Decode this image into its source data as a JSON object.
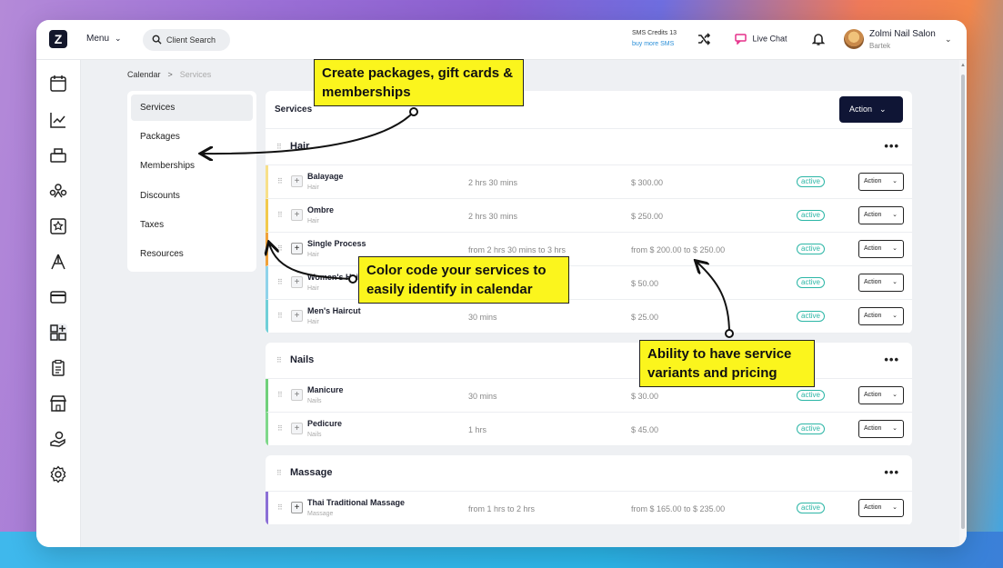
{
  "app": {
    "logo_letter": "Z",
    "menu_label": "Menu",
    "search_label": "Client Search",
    "sms_credits": "SMS Credits 13",
    "buy_sms": "buy more SMS",
    "live_chat": "Live Chat",
    "user_name": "Zolmi Nail Salon",
    "user_sub": "Bartek"
  },
  "breadcrumb": {
    "root": "Calendar",
    "sep": ">",
    "current": "Services"
  },
  "submenu": [
    "Services",
    "Packages",
    "Memberships",
    "Discounts",
    "Taxes",
    "Resources"
  ],
  "main": {
    "title": "Services",
    "action_label": "Action"
  },
  "categories": [
    {
      "name": "Hair",
      "rows": [
        {
          "name": "Balayage",
          "cat": "Hair",
          "duration": "2 hrs 30 mins",
          "price": "$ 300.00",
          "status": "active",
          "action": "Action",
          "color": "#f7e08a",
          "plus_dark": false
        },
        {
          "name": "Ombre",
          "cat": "Hair",
          "duration": "2 hrs 30 mins",
          "price": "$ 250.00",
          "status": "active",
          "action": "Action",
          "color": "#f2c94c",
          "plus_dark": false
        },
        {
          "name": "Single Process",
          "cat": "Hair",
          "duration": "from 2 hrs 30 mins to 3 hrs",
          "price": "from $ 200.00 to $ 250.00",
          "status": "active",
          "action": "Action",
          "color": "#f0a23a",
          "plus_dark": true
        },
        {
          "name": "Women's Haircut",
          "cat": "Hair",
          "duration": "",
          "price": "$ 50.00",
          "status": "active",
          "action": "Action",
          "color": "#8fd3ea",
          "plus_dark": false
        },
        {
          "name": "Men's Haircut",
          "cat": "Hair",
          "duration": "30 mins",
          "price": "$ 25.00",
          "status": "active",
          "action": "Action",
          "color": "#6fcfd8",
          "plus_dark": false
        }
      ]
    },
    {
      "name": "Nails",
      "rows": [
        {
          "name": "Manicure",
          "cat": "Nails",
          "duration": "30 mins",
          "price": "$ 30.00",
          "status": "active",
          "action": "Action",
          "color": "#6fd07a",
          "plus_dark": false
        },
        {
          "name": "Pedicure",
          "cat": "Nails",
          "duration": "1 hrs",
          "price": "$ 45.00",
          "status": "active",
          "action": "Action",
          "color": "#7fd88a",
          "plus_dark": false
        }
      ]
    },
    {
      "name": "Massage",
      "rows": [
        {
          "name": "Thai Traditional Massage",
          "cat": "Massage",
          "duration": "from 1 hrs to 2 hrs",
          "price": "from $ 165.00 to $ 235.00",
          "status": "active",
          "action": "Action",
          "color": "#8b6fd6",
          "plus_dark": true
        }
      ]
    }
  ],
  "callouts": {
    "packages": "Create packages, gift cards & memberships",
    "color": "Color code your services to easily identify in calendar",
    "variants": "Ability to have service variants and pricing"
  },
  "colors": {
    "accent": "#0f1535",
    "active": "#2cb6a6",
    "callout": "#fbf51d"
  }
}
